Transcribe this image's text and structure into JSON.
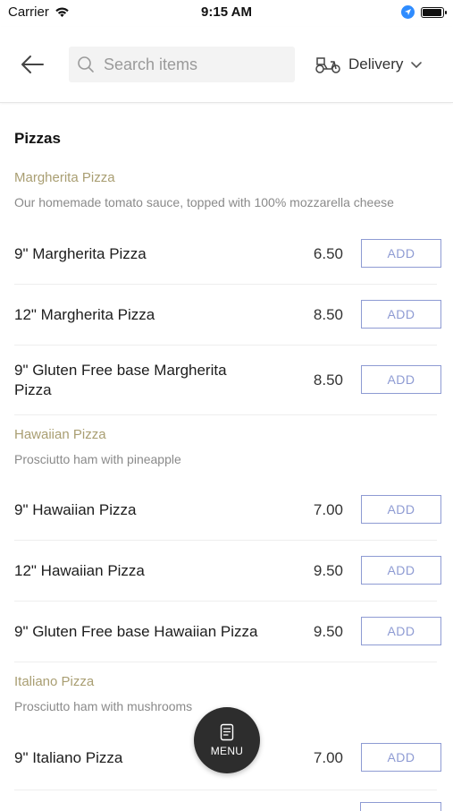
{
  "status_bar": {
    "carrier": "Carrier",
    "time": "9:15 AM"
  },
  "header": {
    "search_placeholder": "Search items",
    "delivery_label": "Delivery"
  },
  "section": {
    "title": "Pizzas"
  },
  "categories": [
    {
      "name": "Margherita Pizza",
      "description": "Our homemade tomato sauce, topped with 100% mozzarella cheese"
    },
    {
      "name": "Hawaiian Pizza",
      "description": "Prosciutto ham with pineapple"
    },
    {
      "name": "Italiano Pizza",
      "description": "Prosciutto ham with mushrooms"
    }
  ],
  "items": [
    {
      "name": "9\" Margherita Pizza",
      "price": "6.50"
    },
    {
      "name": "12\" Margherita Pizza",
      "price": "8.50"
    },
    {
      "name": "9\" Gluten Free base Margherita Pizza",
      "price": "8.50"
    },
    {
      "name": "9\" Hawaiian Pizza",
      "price": "7.00"
    },
    {
      "name": "12\" Hawaiian Pizza",
      "price": "9.50"
    },
    {
      "name": "9\" Gluten Free base Hawaiian Pizza",
      "price": "9.50"
    },
    {
      "name": "9\" Italiano Pizza",
      "price": "7.00"
    }
  ],
  "add_label": "ADD",
  "fab": {
    "label": "MENU"
  },
  "colors": {
    "accent": "#8e9bd3",
    "category": "#a99e72"
  }
}
